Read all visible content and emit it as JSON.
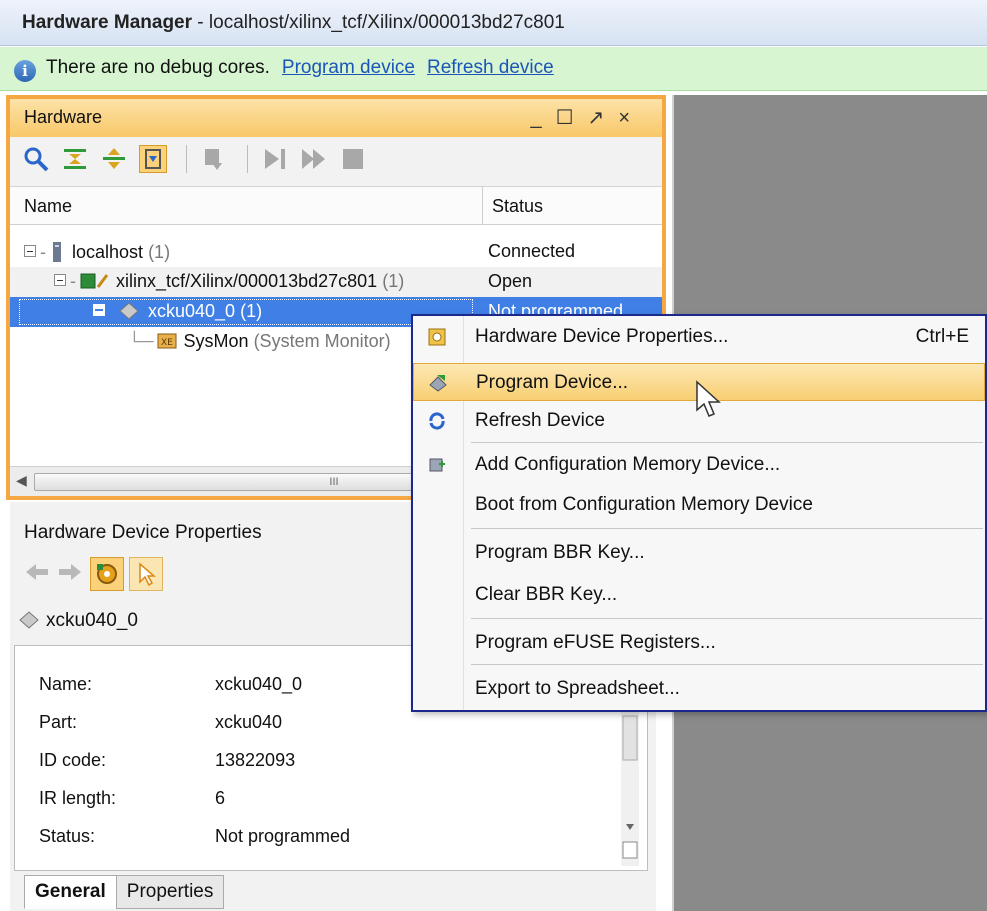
{
  "title": {
    "app": "Hardware Manager",
    "path": " - localhost/xilinx_tcf/Xilinx/000013bd27c801"
  },
  "infobar": {
    "message": "There are no debug cores.",
    "link_program": "Program device",
    "link_refresh": "Refresh device"
  },
  "hardware_panel": {
    "title": "Hardware",
    "columns": {
      "name": "Name",
      "status": "Status"
    },
    "rows": [
      {
        "name": "localhost",
        "count": "(1)",
        "status": "Connected"
      },
      {
        "name": "xilinx_tcf/Xilinx/000013bd27c801",
        "count": "(1)",
        "status": "Open"
      },
      {
        "name": "xcku040_0",
        "count": "(1)",
        "status": "Not programmed"
      },
      {
        "name": "SysMon",
        "sub": "(System Monitor)",
        "status": ""
      }
    ],
    "scroll_grip": "III"
  },
  "properties_panel": {
    "title": "Hardware Device Properties",
    "device": "xcku040_0",
    "fields": [
      {
        "label": "Name:",
        "value": "xcku040_0"
      },
      {
        "label": "Part:",
        "value": "xcku040"
      },
      {
        "label": "ID code:",
        "value": "13822093"
      },
      {
        "label": "IR length:",
        "value": "6"
      },
      {
        "label": "Status:",
        "value": "Not programmed"
      }
    ],
    "tabs": [
      "General",
      "Properties"
    ]
  },
  "context_menu": {
    "items": [
      {
        "label": "Hardware Device Properties...",
        "shortcut": "Ctrl+E"
      },
      {
        "label": "Program Device...",
        "shortcut": ""
      },
      {
        "label": "Refresh Device",
        "shortcut": ""
      },
      {
        "label": "Add Configuration Memory Device...",
        "shortcut": ""
      },
      {
        "label": "Boot from Configuration Memory Device",
        "shortcut": ""
      },
      {
        "label": "Program BBR Key...",
        "shortcut": ""
      },
      {
        "label": "Clear BBR Key...",
        "shortcut": ""
      },
      {
        "label": "Program eFUSE Registers...",
        "shortcut": ""
      },
      {
        "label": "Export to Spreadsheet...",
        "shortcut": ""
      }
    ]
  },
  "colors": {
    "accent_orange": "#f4a742",
    "selection_blue": "#3f7fe6",
    "menu_border": "#1b2a8a",
    "info_green": "#d6f5d0"
  }
}
